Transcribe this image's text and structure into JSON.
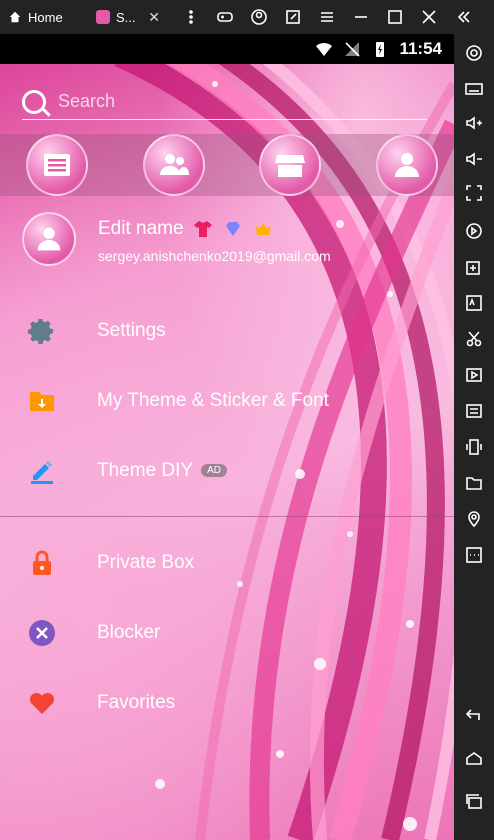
{
  "emulator": {
    "tabs": [
      {
        "label": "Home"
      },
      {
        "label": "S..."
      }
    ],
    "controls": [
      "gamepad-icon",
      "account-icon",
      "screenshot-icon",
      "menu-icon",
      "minimize-icon",
      "maximize-icon",
      "close-icon",
      "collapse-icon"
    ],
    "sidebar": [
      "settings-icon",
      "keyboard-icon",
      "volume-up-icon",
      "volume-down-icon",
      "fullscreen-icon",
      "sync-icon",
      "add-window-icon",
      "apk-icon",
      "cut-icon",
      "video-icon",
      "transfer-icon",
      "shake-icon",
      "folder-icon",
      "location-icon",
      "more-icon",
      "back-icon",
      "home-icon",
      "recents-icon"
    ]
  },
  "status_bar": {
    "time": "11:54"
  },
  "search": {
    "placeholder": "Search"
  },
  "profile": {
    "name": "Edit name",
    "email": "sergey.anishchenko2019@gmail.com"
  },
  "menu": [
    {
      "label": "Settings",
      "icon": "gear-icon",
      "color": "#607D8B"
    },
    {
      "label": "My Theme & Sticker & Font",
      "icon": "folder-download-icon",
      "color": "#FF9800"
    },
    {
      "label": "Theme DIY",
      "icon": "edit-icon",
      "color": "#2196F3",
      "badge": "AD"
    },
    {
      "label": "Private Box",
      "icon": "lock-icon",
      "color": "#FF5722"
    },
    {
      "label": "Blocker",
      "icon": "block-icon",
      "color": "#7E57C2"
    },
    {
      "label": "Favorites",
      "icon": "heart-icon",
      "color": "#F44336"
    }
  ]
}
